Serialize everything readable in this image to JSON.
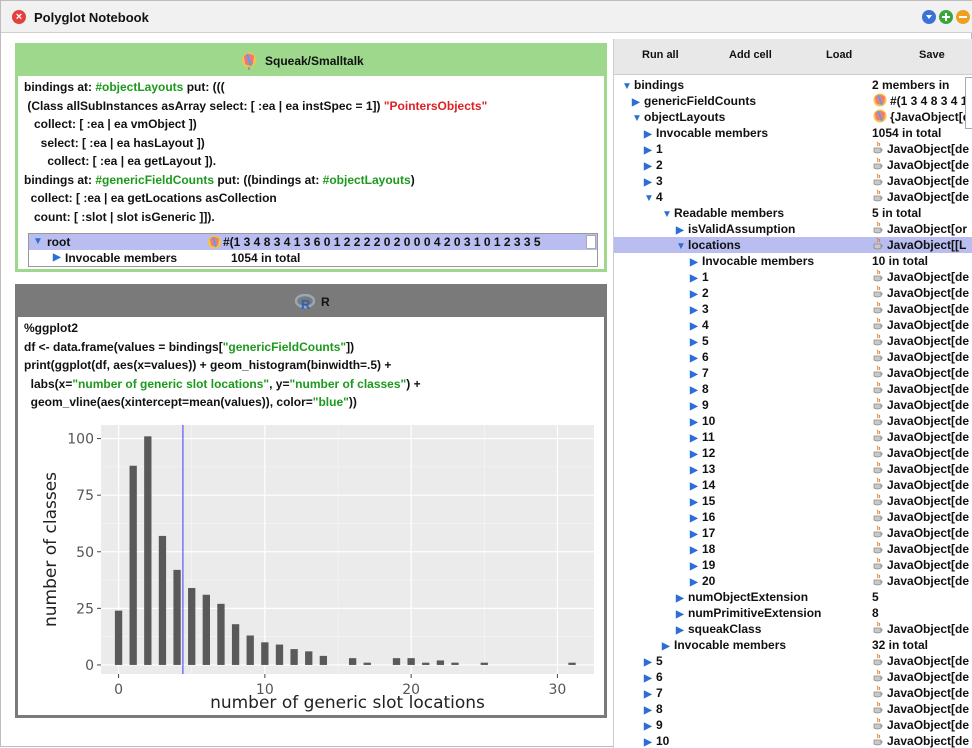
{
  "window": {
    "title": "Polyglot Notebook",
    "close_glyph": "×"
  },
  "cell1": {
    "title": "Squeak/Smalltalk",
    "lines": [
      [
        {
          "t": "bindings at: ",
          "c": ""
        },
        {
          "t": "#objectLayouts",
          "c": "g"
        },
        {
          "t": " put: (((",
          "c": ""
        }
      ],
      [
        {
          "t": " (Class allSubInstances asArray select: [ :ea | ea instSpec = 1]) ",
          "c": ""
        },
        {
          "t": "\"PointersObjects\"",
          "c": "r"
        }
      ],
      [
        {
          "t": "   collect: [ :ea | ea vmObject ])",
          "c": ""
        }
      ],
      [
        {
          "t": "     select: [ :ea | ea hasLayout ])",
          "c": ""
        }
      ],
      [
        {
          "t": "       collect: [ :ea | ea getLayout ]).",
          "c": ""
        }
      ],
      [
        {
          "t": "bindings at: ",
          "c": ""
        },
        {
          "t": "#genericFieldCounts",
          "c": "g"
        },
        {
          "t": " put: ((bindings at: ",
          "c": ""
        },
        {
          "t": "#objectLayouts",
          "c": "g"
        },
        {
          "t": ")",
          "c": ""
        }
      ],
      [
        {
          "t": "  collect: [ :ea | ea getLocations asCollection",
          "c": ""
        }
      ],
      [
        {
          "t": "   count: [ :slot | slot isGeneric ]]).",
          "c": ""
        }
      ]
    ],
    "inspector": {
      "root_label": "root",
      "root_value": "#(1 3 4 8 3 4 1 3 6 0 1 2 2 2 2 0 2 0 0 0 4 2 0 3 1 0 1 2 3 3 5",
      "child_label": "Invocable members",
      "child_value": "1054 in total"
    }
  },
  "cell2": {
    "title": "R",
    "lines": [
      [
        {
          "t": "%ggplot2",
          "c": ""
        }
      ],
      [
        {
          "t": "df <- data.frame(values = bindings[",
          "c": ""
        },
        {
          "t": "\"genericFieldCounts\"",
          "c": "g"
        },
        {
          "t": "])",
          "c": ""
        }
      ],
      [
        {
          "t": "print(ggplot(df, aes(x=values)) + geom_histogram(binwidth=.5) +",
          "c": ""
        }
      ],
      [
        {
          "t": "  labs(x=",
          "c": ""
        },
        {
          "t": "\"number of generic slot locations\"",
          "c": "g"
        },
        {
          "t": ", y=",
          "c": ""
        },
        {
          "t": "\"number of classes\"",
          "c": "g"
        },
        {
          "t": ") +",
          "c": ""
        }
      ],
      [
        {
          "t": "  geom_vline(aes(xintercept=mean(values)), color=",
          "c": ""
        },
        {
          "t": "\"blue\"",
          "c": "g"
        },
        {
          "t": "))",
          "c": ""
        }
      ]
    ]
  },
  "toolbar": {
    "run_all": "Run all",
    "add_cell": "Add cell",
    "load": "Load",
    "save": "Save"
  },
  "tree": [
    {
      "label": "bindings",
      "value": "2 members in",
      "depth": 0,
      "open": true,
      "icon": ""
    },
    {
      "label": "genericFieldCounts",
      "value": "#(1 3 4 8 3 4 1",
      "depth": 1,
      "open": false,
      "icon": "squeak"
    },
    {
      "label": "objectLayouts",
      "value": "{JavaObject[d",
      "depth": 1,
      "open": true,
      "icon": "squeak"
    },
    {
      "label": "Invocable members",
      "value": "1054 in total",
      "depth": 2,
      "open": false,
      "icon": ""
    },
    {
      "label": "1",
      "value": "JavaObject[de",
      "depth": 2,
      "open": false,
      "icon": "java"
    },
    {
      "label": "2",
      "value": "JavaObject[de",
      "depth": 2,
      "open": false,
      "icon": "java"
    },
    {
      "label": "3",
      "value": "JavaObject[de",
      "depth": 2,
      "open": false,
      "icon": "java"
    },
    {
      "label": "4",
      "value": "JavaObject[de",
      "depth": 2,
      "open": true,
      "icon": "java"
    },
    {
      "label": "Readable members",
      "value": "5 in total",
      "depth": 3,
      "open": true,
      "icon": ""
    },
    {
      "label": "isValidAssumption",
      "value": "JavaObject[or",
      "depth": 4,
      "open": false,
      "icon": "java"
    },
    {
      "label": "locations",
      "value": "JavaObject[[L",
      "depth": 4,
      "open": true,
      "icon": "java",
      "selected": true
    },
    {
      "label": "Invocable members",
      "value": "10 in total",
      "depth": 5,
      "open": false,
      "icon": ""
    },
    {
      "label": "1",
      "value": "JavaObject[de",
      "depth": 5,
      "open": false,
      "icon": "java"
    },
    {
      "label": "2",
      "value": "JavaObject[de",
      "depth": 5,
      "open": false,
      "icon": "java"
    },
    {
      "label": "3",
      "value": "JavaObject[de",
      "depth": 5,
      "open": false,
      "icon": "java"
    },
    {
      "label": "4",
      "value": "JavaObject[de",
      "depth": 5,
      "open": false,
      "icon": "java"
    },
    {
      "label": "5",
      "value": "JavaObject[de",
      "depth": 5,
      "open": false,
      "icon": "java"
    },
    {
      "label": "6",
      "value": "JavaObject[de",
      "depth": 5,
      "open": false,
      "icon": "java"
    },
    {
      "label": "7",
      "value": "JavaObject[de",
      "depth": 5,
      "open": false,
      "icon": "java"
    },
    {
      "label": "8",
      "value": "JavaObject[de",
      "depth": 5,
      "open": false,
      "icon": "java"
    },
    {
      "label": "9",
      "value": "JavaObject[de",
      "depth": 5,
      "open": false,
      "icon": "java"
    },
    {
      "label": "10",
      "value": "JavaObject[de",
      "depth": 5,
      "open": false,
      "icon": "java"
    },
    {
      "label": "11",
      "value": "JavaObject[de",
      "depth": 5,
      "open": false,
      "icon": "java"
    },
    {
      "label": "12",
      "value": "JavaObject[de",
      "depth": 5,
      "open": false,
      "icon": "java"
    },
    {
      "label": "13",
      "value": "JavaObject[de",
      "depth": 5,
      "open": false,
      "icon": "java"
    },
    {
      "label": "14",
      "value": "JavaObject[de",
      "depth": 5,
      "open": false,
      "icon": "java"
    },
    {
      "label": "15",
      "value": "JavaObject[de",
      "depth": 5,
      "open": false,
      "icon": "java"
    },
    {
      "label": "16",
      "value": "JavaObject[de",
      "depth": 5,
      "open": false,
      "icon": "java"
    },
    {
      "label": "17",
      "value": "JavaObject[de",
      "depth": 5,
      "open": false,
      "icon": "java"
    },
    {
      "label": "18",
      "value": "JavaObject[de",
      "depth": 5,
      "open": false,
      "icon": "java"
    },
    {
      "label": "19",
      "value": "JavaObject[de",
      "depth": 5,
      "open": false,
      "icon": "java"
    },
    {
      "label": "20",
      "value": "JavaObject[de",
      "depth": 5,
      "open": false,
      "icon": "java"
    },
    {
      "label": "numObjectExtension",
      "value": "5",
      "depth": 4,
      "open": false,
      "icon": ""
    },
    {
      "label": "numPrimitiveExtension",
      "value": "8",
      "depth": 4,
      "open": false,
      "icon": ""
    },
    {
      "label": "squeakClass",
      "value": "JavaObject[de",
      "depth": 4,
      "open": false,
      "icon": "java"
    },
    {
      "label": "Invocable members",
      "value": "32 in total",
      "depth": 3,
      "open": false,
      "icon": ""
    },
    {
      "label": "5",
      "value": "JavaObject[de",
      "depth": 2,
      "open": false,
      "icon": "java"
    },
    {
      "label": "6",
      "value": "JavaObject[de",
      "depth": 2,
      "open": false,
      "icon": "java"
    },
    {
      "label": "7",
      "value": "JavaObject[de",
      "depth": 2,
      "open": false,
      "icon": "java"
    },
    {
      "label": "8",
      "value": "JavaObject[de",
      "depth": 2,
      "open": false,
      "icon": "java"
    },
    {
      "label": "9",
      "value": "JavaObject[de",
      "depth": 2,
      "open": false,
      "icon": "java"
    },
    {
      "label": "10",
      "value": "JavaObject[de",
      "depth": 2,
      "open": false,
      "icon": "java"
    }
  ],
  "colors": {
    "blue_line": "#3b3bff",
    "bar": "#595959",
    "panel_bg": "#ebebeb",
    "tree_triangle": "#2a6fd8",
    "selection": "#b9bdf0"
  },
  "chart_data": {
    "type": "bar",
    "title": "",
    "xlabel": "number of generic slot locations",
    "ylabel": "number of classes",
    "x": [
      0,
      1,
      2,
      3,
      4,
      5,
      6,
      7,
      8,
      9,
      10,
      11,
      12,
      13,
      14,
      16,
      17,
      19,
      20,
      21,
      22,
      23,
      25,
      31
    ],
    "values": [
      24,
      88,
      101,
      57,
      42,
      34,
      31,
      27,
      18,
      13,
      10,
      9,
      7,
      6,
      4,
      3,
      1,
      3,
      3,
      1,
      2,
      1,
      1,
      1
    ],
    "vline_x": 4.4,
    "xlim": [
      -1.2,
      32.5
    ],
    "ylim": [
      -4,
      106
    ],
    "xticks": [
      0,
      10,
      20,
      30
    ],
    "yticks": [
      0,
      25,
      50,
      75,
      100
    ],
    "grid": true
  }
}
